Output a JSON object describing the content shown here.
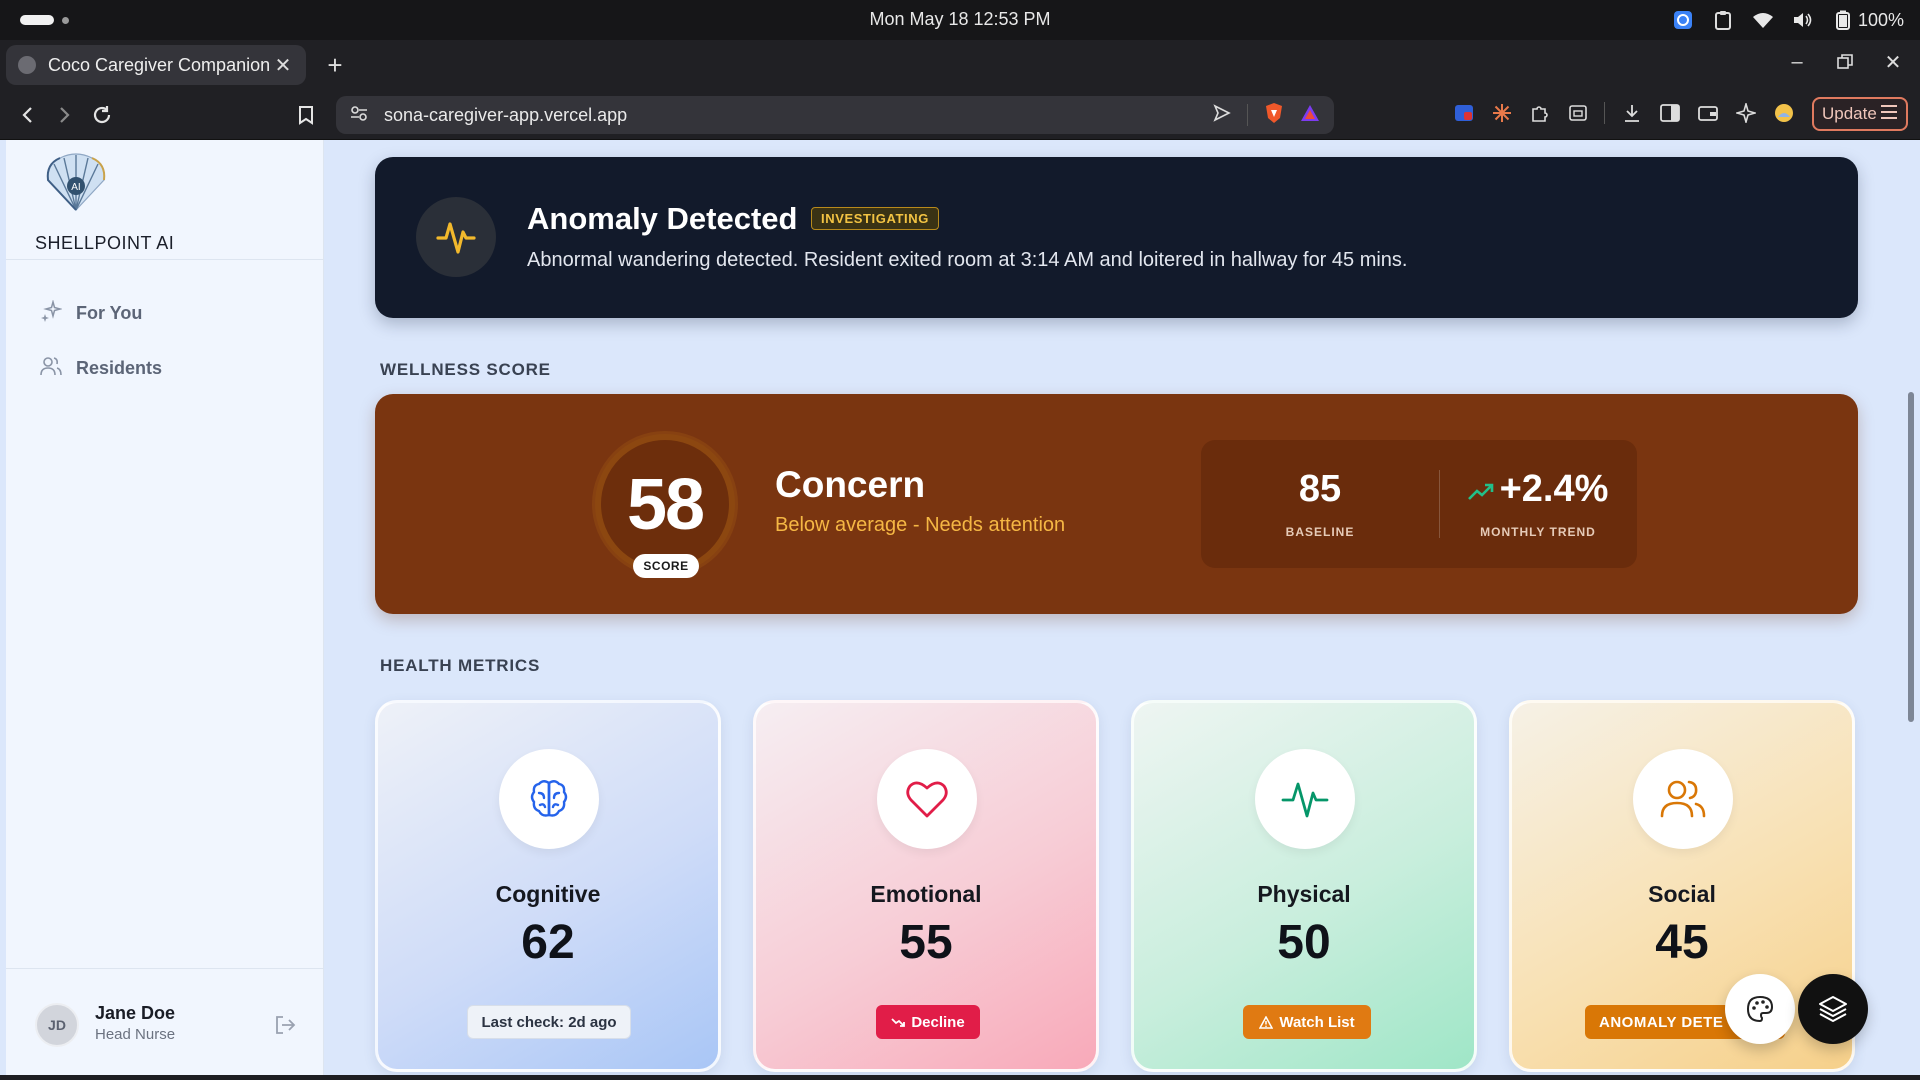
{
  "os": {
    "clock": "Mon May 18  12:53 PM",
    "battery": "100%"
  },
  "browser": {
    "tab_title": "Coco Caregiver Companion",
    "url": "sona-caregiver-app.vercel.app",
    "update_label": "Update"
  },
  "sidebar": {
    "brand": "SHELLPOINT AI",
    "logo_text": "AI",
    "items": [
      {
        "label": "For You",
        "icon": "sparkles-icon"
      },
      {
        "label": "Residents",
        "icon": "users-icon"
      }
    ],
    "user": {
      "initials": "JD",
      "name": "Jane Doe",
      "role": "Head Nurse"
    }
  },
  "anomaly": {
    "title": "Anomaly Detected",
    "badge": "INVESTIGATING",
    "description": "Abnormal wandering detected. Resident exited room at 3:14 AM and loitered in hallway for 45 mins."
  },
  "wellness": {
    "section_label": "WELLNESS SCORE",
    "score": "58",
    "score_label": "SCORE",
    "status": "Concern",
    "status_detail": "Below average - Needs attention",
    "baseline_value": "85",
    "baseline_label": "BASELINE",
    "trend_value": "+2.4%",
    "trend_label": "MONTHLY TREND"
  },
  "metrics": {
    "section_label": "HEALTH METRICS",
    "cards": [
      {
        "title": "Cognitive",
        "value": "62",
        "badge": "Last check: 2d ago",
        "icon": "brain-icon"
      },
      {
        "title": "Emotional",
        "value": "55",
        "badge": "Decline",
        "icon": "heart-icon"
      },
      {
        "title": "Physical",
        "value": "50",
        "badge": "Watch List",
        "icon": "activity-icon"
      },
      {
        "title": "Social",
        "value": "45",
        "badge": "ANOMALY DETE",
        "icon": "users-icon"
      }
    ]
  },
  "colors": {
    "anomaly_bg": "#121a2b",
    "wellness_bg": "#7a3510",
    "accent_yellow": "#f3c343",
    "decline_red": "#e11d48",
    "watch_orange": "#e07a12"
  }
}
